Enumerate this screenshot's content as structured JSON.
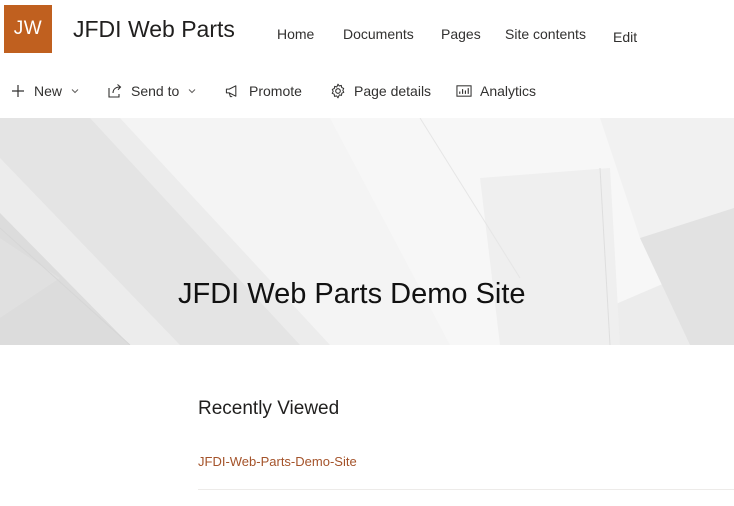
{
  "site": {
    "logo_initials": "JW",
    "title": "JFDI Web Parts"
  },
  "nav": {
    "items": [
      "Home",
      "Documents",
      "Pages",
      "Site contents",
      "Edit"
    ]
  },
  "commands": {
    "new_label": "New",
    "send_to_label": "Send to",
    "promote_label": "Promote",
    "page_details_label": "Page details",
    "analytics_label": "Analytics"
  },
  "hero": {
    "title": "JFDI Web Parts Demo Site"
  },
  "recent": {
    "title": "Recently Viewed",
    "items": [
      "JFDI-Web-Parts-Demo-Site"
    ]
  },
  "colors": {
    "brand": "#c0601f",
    "link": "#a4532a"
  }
}
